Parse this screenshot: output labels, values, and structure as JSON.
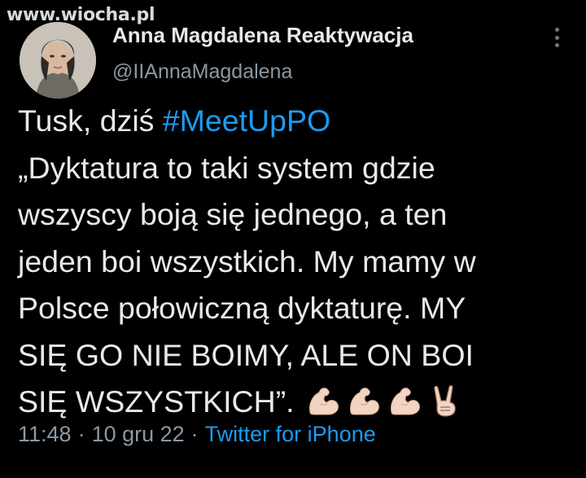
{
  "watermark": {
    "text": "www.wiocha.pl"
  },
  "header": {
    "display_name": "Anna Magdalena Reaktywacja",
    "handle": "@IIAnnaMagdalena",
    "more_icon": "more-vertical-icon"
  },
  "tweet": {
    "line1": {
      "text": "Tusk, dziś ",
      "hashtag": "#MeetUpPO"
    },
    "line2": "„Dyktatura to taki system gdzie",
    "line3": "wszyscy boją się jednego, a ten",
    "line4": "jeden boi wszystkich. My mamy w",
    "line5": "Polsce połowiczną dyktaturę. MY",
    "line6": "SIĘ GO NIE BOIMY, ALE ON BOI",
    "line7": "SIĘ WSZYSTKICH”.",
    "emojis": [
      "flexed-biceps-icon",
      "flexed-biceps-icon",
      "flexed-biceps-icon",
      "victory-hand-icon"
    ]
  },
  "meta": {
    "time": "11:48",
    "separator": "·",
    "date": "10 gru 22",
    "source": "Twitter for iPhone"
  },
  "colors": {
    "background": "#000000",
    "text": "#e7e9ea",
    "secondary": "#8b98a5",
    "link": "#1d9bf0"
  }
}
